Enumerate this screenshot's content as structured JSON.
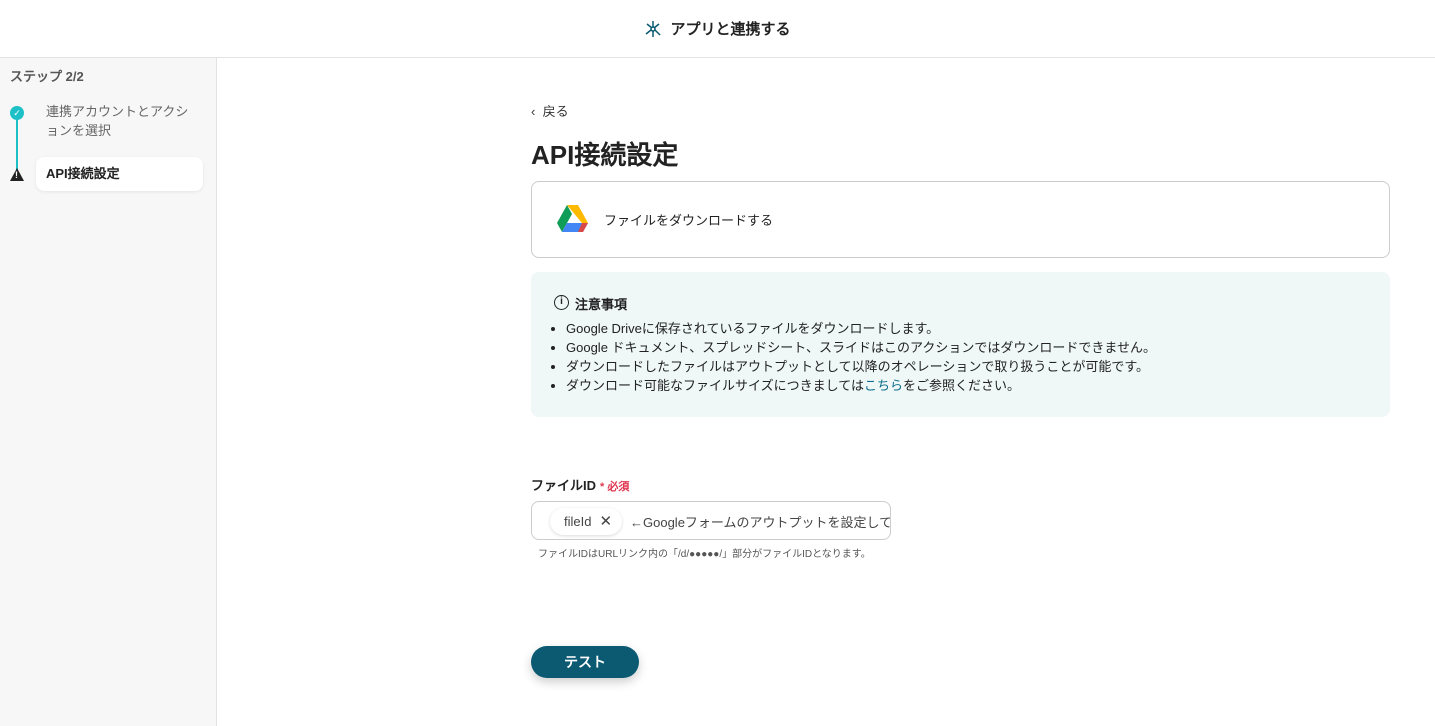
{
  "header": {
    "title": "アプリと連携する",
    "icon": "network-icon"
  },
  "sidebar": {
    "step": "ステップ 2/2",
    "items": [
      {
        "label": "連携アカウントとアクションを選択",
        "status": "done"
      },
      {
        "label": "API接続設定",
        "status": "warning"
      }
    ]
  },
  "main": {
    "back": "戻る",
    "title": "API接続設定",
    "action": "ファイルをダウンロードする",
    "note": {
      "title": "注意事項",
      "items": [
        "Google Driveに保存されているファイルをダウンロードします。",
        "Google ドキュメント、スプレッドシート、スライドはこのアクションではダウンロードできません。",
        "ダウンロードしたファイルはアウトプットとして以降のオペレーションで取り扱うことが可能です。"
      ],
      "last_prefix": "ダウンロード可能なファイルサイズにつきましては",
      "last_link": "こちら",
      "last_suffix": "をご参照ください。"
    },
    "field": {
      "label": "ファイルID",
      "required_mark": "*",
      "required": "必須",
      "chip": "fileId",
      "text": "←Googleフォームのアウトプットを設定してください",
      "help": "ファイルIDはURLリンク内の「/d/●●●●●/」部分がファイルIDとなります。"
    },
    "test": "テスト"
  },
  "colors": {
    "accent": "#1ec0c8",
    "button": "#0b5a72",
    "required": "#e0364f"
  }
}
